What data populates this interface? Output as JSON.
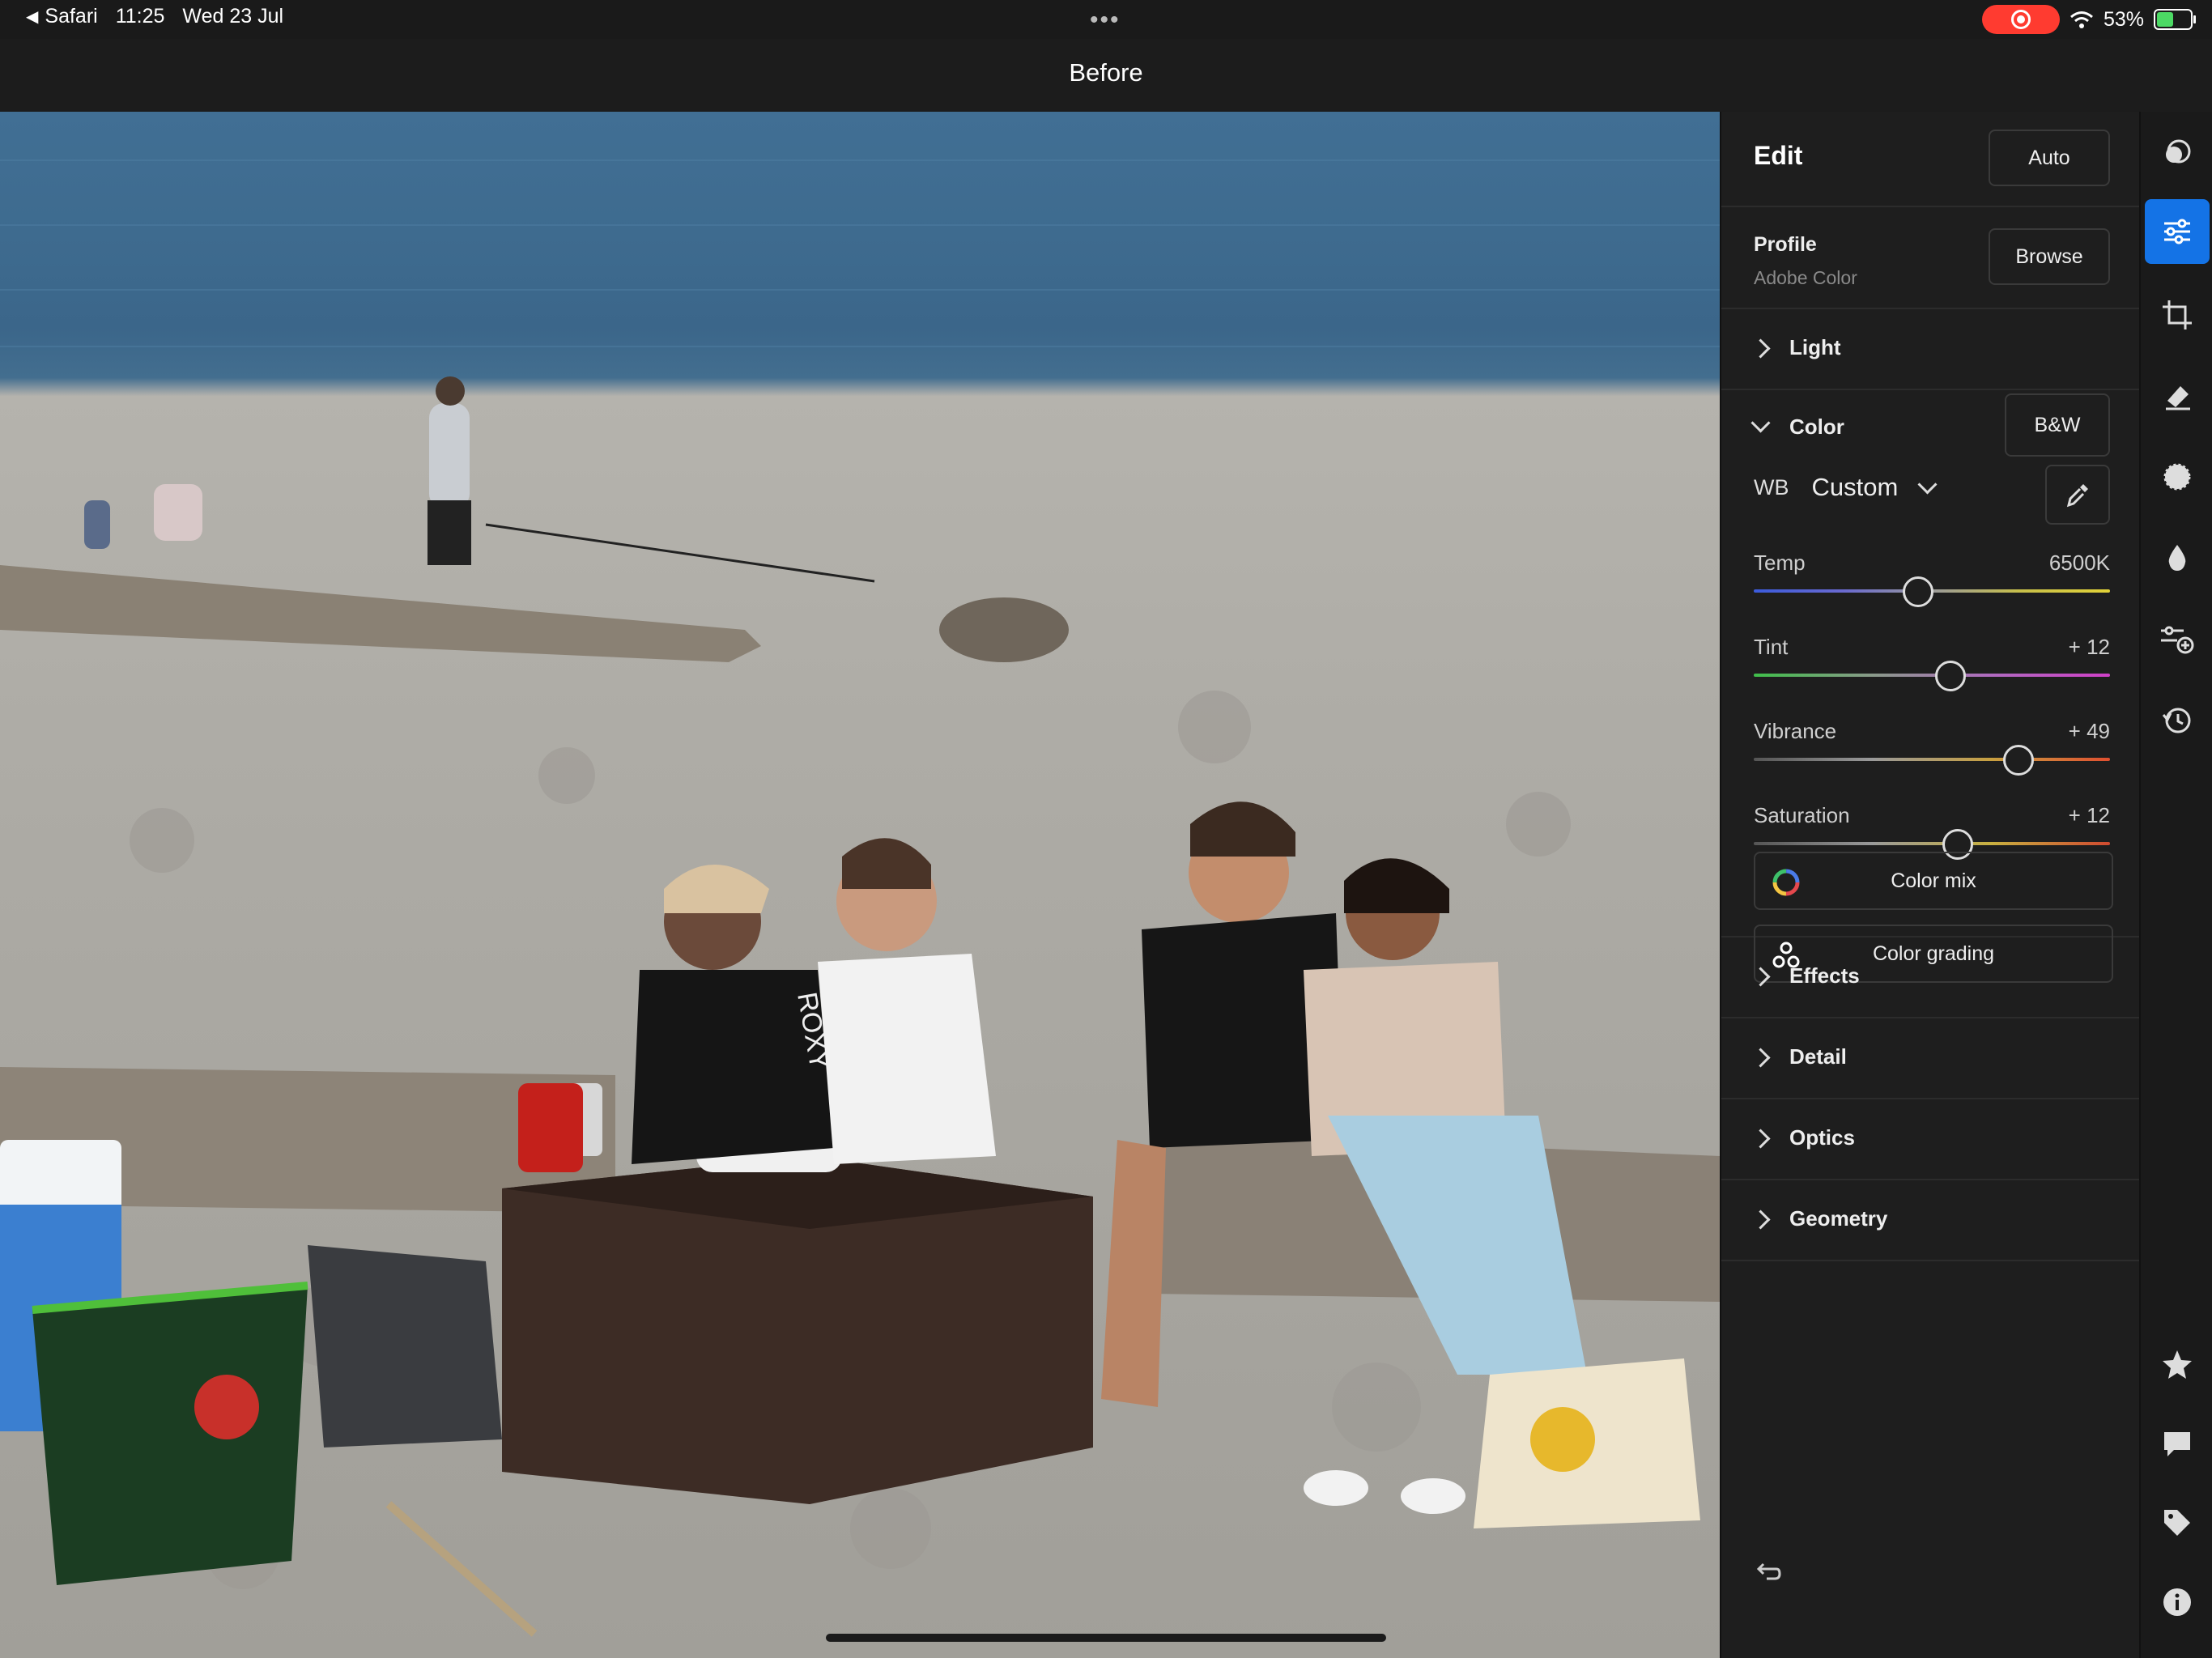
{
  "status_bar": {
    "back_app": "Safari",
    "time": "11:25",
    "date": "Wed 23 Jul",
    "battery": "53%",
    "battery_level": 0.53
  },
  "title_bar": {
    "title": "Before"
  },
  "edit_panel": {
    "title": "Edit",
    "auto_label": "Auto",
    "profile": {
      "label": "Profile",
      "value": "Adobe Color",
      "browse_label": "Browse"
    },
    "sections": {
      "light": "Light",
      "color": "Color",
      "effects": "Effects",
      "detail": "Detail",
      "optics": "Optics",
      "geometry": "Geometry"
    },
    "bw_label": "B&W",
    "wb": {
      "label": "WB",
      "value": "Custom"
    },
    "sliders": [
      {
        "name": "Temp",
        "value": "6500K",
        "position": 0.46
      },
      {
        "name": "Tint",
        "value": "+ 12",
        "position": 0.55
      },
      {
        "name": "Vibrance",
        "value": "+ 49",
        "position": 0.74
      },
      {
        "name": "Saturation",
        "value": "+ 12",
        "position": 0.57
      }
    ],
    "color_mix_label": "Color mix",
    "color_grading_label": "Color grading"
  },
  "photo_sign": "ROXY",
  "colors": {
    "accent": "#1473e6",
    "panel_bg": "#1e1e1e",
    "record": "#ff3b30"
  }
}
